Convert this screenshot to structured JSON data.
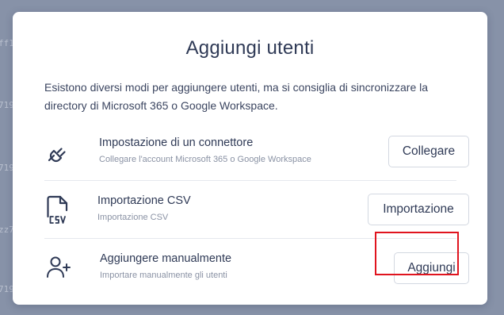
{
  "modal": {
    "title": "Aggiungi utenti",
    "description": "Esistono diversi modi per aggiungere utenti, ma si consiglia di sincronizzare la directory di Microsoft 365 o Google Workspace."
  },
  "options": [
    {
      "icon": "plug-icon",
      "title": "Impostazione di un connettore",
      "subtitle": "Collegare l'account Microsoft 365 o Google Workspace",
      "button": "Collegare"
    },
    {
      "icon": "csv-file-icon",
      "title": "Importazione CSV",
      "subtitle": "Importazione CSV",
      "button": "Importazione"
    },
    {
      "icon": "add-user-icon",
      "title": "Aggiungere manualmente",
      "subtitle": "Importare manualmente gli utenti",
      "button": "Aggiungi"
    }
  ],
  "backdrop": {
    "fragments": [
      "ff14",
      "719",
      "719",
      "zz7",
      "719"
    ]
  },
  "colors": {
    "backdrop": "#8792a8",
    "text": "#2f3a56",
    "highlight": "#e0141e"
  }
}
